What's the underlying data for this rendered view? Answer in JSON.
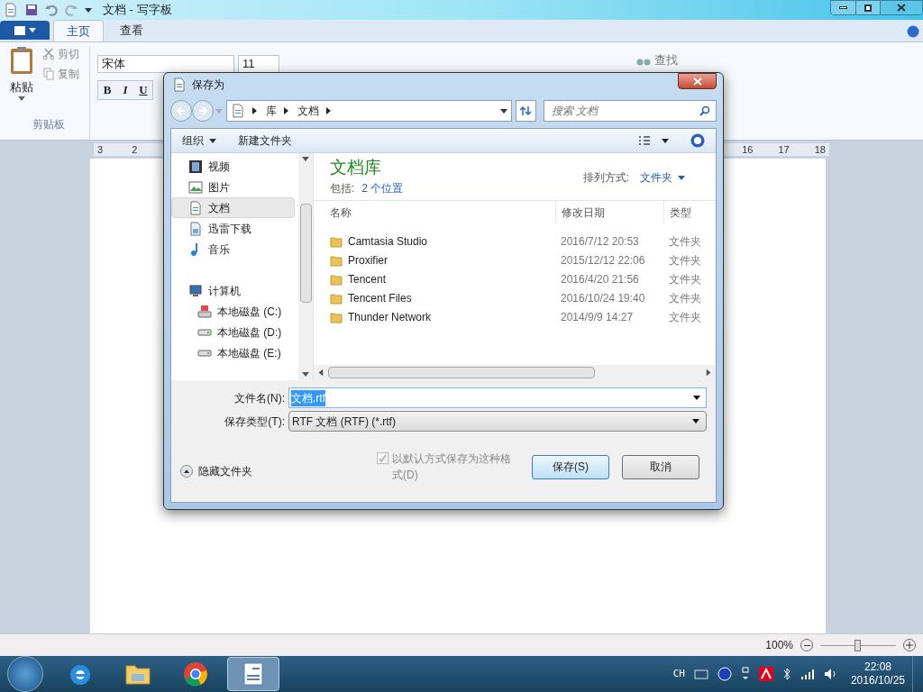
{
  "window": {
    "title": "文档 - 写字板"
  },
  "ribbon": {
    "tabs": [
      {
        "label": "主页",
        "selected": true
      },
      {
        "label": "查看",
        "selected": false
      }
    ],
    "paste": "粘贴",
    "cut": "剪切",
    "copy": "复制",
    "clipboard_group": "剪贴板",
    "font_family": "宋体",
    "font_size": "11",
    "format_buttons": [
      "B",
      "I",
      "U"
    ],
    "find": "查找"
  },
  "ruler": {
    "left_labels": [
      "3",
      "2"
    ],
    "right_labels": [
      "16",
      "17",
      "18"
    ]
  },
  "status_bar": {
    "zoom": "100%",
    "level": 0.5
  },
  "dialog": {
    "title": "保存为",
    "breadcrumb": [
      "库",
      "文档"
    ],
    "search_placeholder": "搜索 文档",
    "organize": "组织",
    "new_folder": "新建文件夹",
    "nav_items": [
      {
        "label": "视频",
        "kind": "video",
        "selected": false
      },
      {
        "label": "图片",
        "kind": "picture",
        "selected": false
      },
      {
        "label": "文档",
        "kind": "document",
        "selected": true
      },
      {
        "label": "迅雷下载",
        "kind": "download",
        "selected": false
      },
      {
        "label": "音乐",
        "kind": "music",
        "selected": false
      },
      {
        "label": "计算机",
        "kind": "computer",
        "selected": false,
        "children": [
          {
            "label": "本地磁盘 (C:)",
            "kind": "system-drive",
            "selected": false
          },
          {
            "label": "本地磁盘 (D:)",
            "kind": "drive",
            "selected": false
          },
          {
            "label": "本地磁盘 (E:)",
            "kind": "drive",
            "selected": false
          }
        ]
      }
    ],
    "library_title": "文档库",
    "includes_label": "包括:",
    "includes_link": "2 个位置",
    "sort_label": "排列方式:",
    "sort_value": "文件夹",
    "columns": [
      "名称",
      "修改日期",
      "类型"
    ],
    "rows": [
      {
        "name": "Camtasia Studio",
        "date": "2016/7/12 20:53",
        "type": "文件夹"
      },
      {
        "name": "Proxifier",
        "date": "2015/12/12 22:06",
        "type": "文件夹"
      },
      {
        "name": "Tencent",
        "date": "2016/4/20 21:56",
        "type": "文件夹"
      },
      {
        "name": "Tencent Files",
        "date": "2016/10/24 19:40",
        "type": "文件夹"
      },
      {
        "name": "Thunder Network",
        "date": "2014/9/9 14:27",
        "type": "文件夹"
      }
    ],
    "filename_label": "文件名(N):",
    "filename": "文档.rtf",
    "type_label": "保存类型(T):",
    "file_type": "RTF 文档 (RTF) (*.rtf)",
    "default_format": {
      "label": "以默认方式保存为这种格式(D)",
      "checked": true,
      "disabled": true
    },
    "hide_folders": "隐藏文件夹",
    "save": "保存(S)",
    "cancel": "取消"
  },
  "taskbar": {
    "apps": [
      {
        "kind": "ie",
        "selected": false
      },
      {
        "kind": "explorer",
        "selected": false
      },
      {
        "kind": "chrome",
        "selected": false
      },
      {
        "kind": "wordpad",
        "selected": true
      }
    ],
    "ime": "CH",
    "time": "22:08",
    "date": "2016/10/25"
  }
}
